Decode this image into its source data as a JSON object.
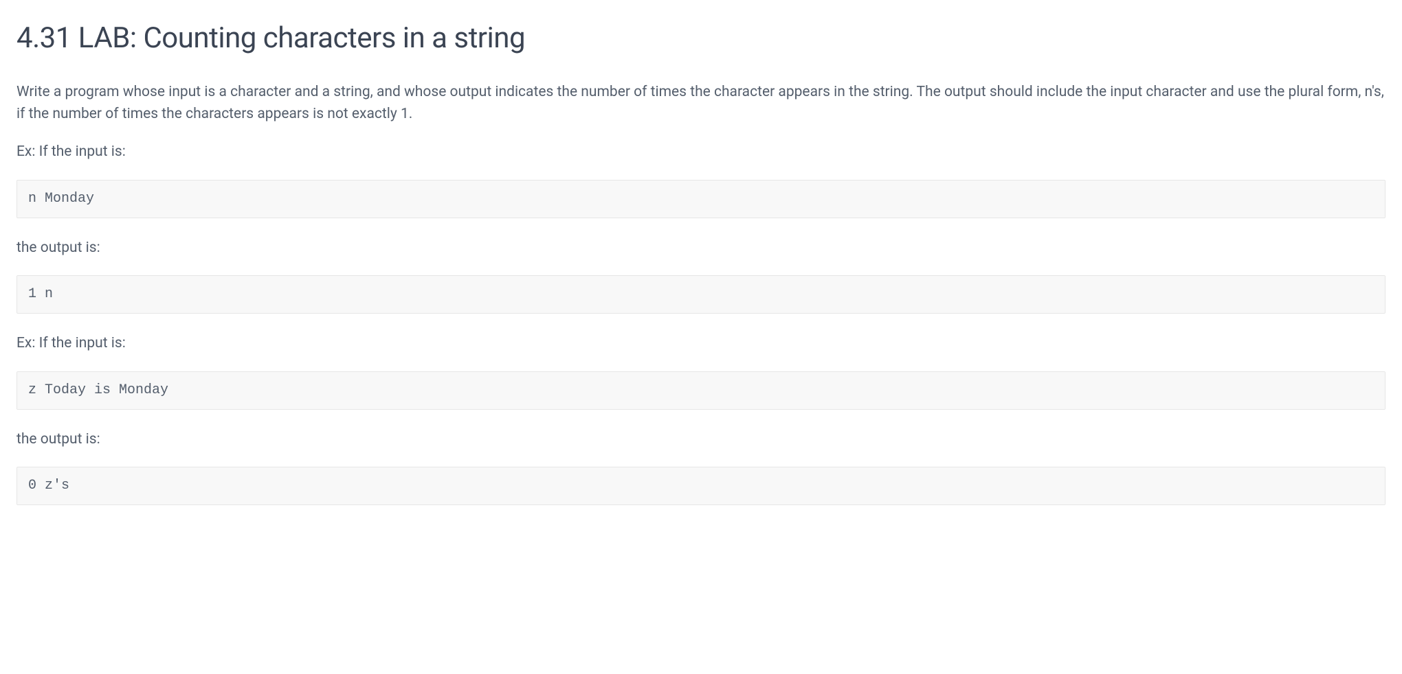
{
  "title": "4.31 LAB: Counting characters in a string",
  "intro": "Write a program whose input is a character and a string, and whose output indicates the number of times the character appears in the string. The output should include the input character and use the plural form, n's, if the number of times the characters appears is not exactly 1.",
  "example1": {
    "label_in": "Ex: If the input is:",
    "input": "n Monday",
    "label_out": "the output is:",
    "output": "1 n"
  },
  "example2": {
    "label_in": "Ex: If the input is:",
    "input": "z Today is Monday",
    "label_out": "the output is:",
    "output": "0 z's"
  }
}
